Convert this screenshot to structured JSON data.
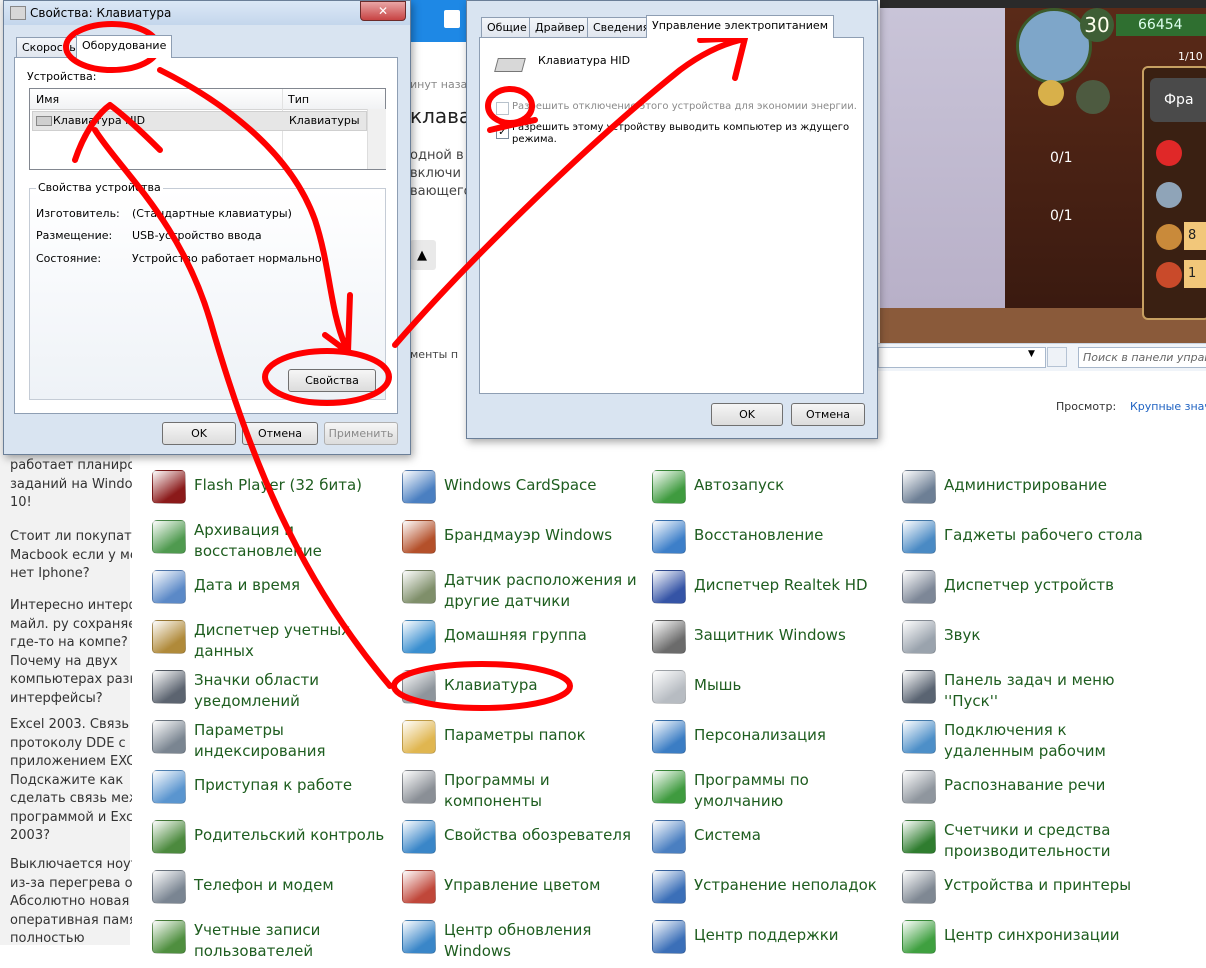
{
  "left_articles": [
    {
      "lines": [
        "работает планиро",
        "заданий на Window",
        "10!"
      ]
    },
    {
      "lines": [
        "Стоит ли покупать",
        "Macbook если у ме",
        "нет Iphone?"
      ]
    },
    {
      "lines": [
        "Интересно интерф",
        "майл. ру сохраняе",
        "где-то на компе?",
        "Почему на двух",
        "компьютерах разн",
        "интерфейсы?"
      ]
    },
    {
      "lines": [
        "Excel 2003. Связь",
        "протоколу DDE с",
        "приложением EXC",
        "Подскажите как",
        "сделать связь меж",
        "программой и Exce",
        "2003?"
      ]
    },
    {
      "lines": [
        "Выключается ноут",
        "из-за перегрева оз",
        "Абсолютно новая",
        "оперативная памя",
        "полностью"
      ]
    }
  ],
  "web_strip": {
    "texts": [
      "инут наза",
      "клава",
      "одной в",
      "включи",
      "вающего",
      "менты п"
    ]
  },
  "game": {
    "level": "30",
    "gold": "66454",
    "counter": "1/10",
    "key1": "0/1",
    "key2": "0/1",
    "panel_label": "Фра",
    "stat1": "8",
    "stat2": "1"
  },
  "control_panel": {
    "search_placeholder": "Поиск в панели управ",
    "view_label": "Просмотр:",
    "view_value": "Крупные знач",
    "items": [
      {
        "label": "Flash Player (32 бита)",
        "icon": "flash-icon",
        "color": "#8b1a1a"
      },
      {
        "label": "Windows CardSpace",
        "icon": "cardspace-icon",
        "color": "#4a7fc1"
      },
      {
        "label": "Автозапуск",
        "icon": "autoplay-icon",
        "color": "#3f9b3f"
      },
      {
        "label": "Администрирование",
        "icon": "admin-tools-icon",
        "color": "#6d7f95"
      },
      {
        "label": "Архивация и\nвосстановление",
        "icon": "backup-icon",
        "color": "#4f9a4f"
      },
      {
        "label": "Брандмауэр Windows",
        "icon": "firewall-icon",
        "color": "#b4502a"
      },
      {
        "label": "Восстановление",
        "icon": "recovery-icon",
        "color": "#3d7fc9"
      },
      {
        "label": "Гаджеты рабочего стола",
        "icon": "gadgets-icon",
        "color": "#4a8ac4"
      },
      {
        "label": "Дата и время",
        "icon": "datetime-icon",
        "color": "#5b89c7"
      },
      {
        "label": "Датчик расположения и\nдругие датчики",
        "icon": "sensor-icon",
        "color": "#7f8f6a"
      },
      {
        "label": "Диспетчер Realtek HD",
        "icon": "realtek-icon",
        "color": "#3554a6"
      },
      {
        "label": "Диспетчер устройств",
        "icon": "device-manager-icon",
        "color": "#7d8797"
      },
      {
        "label": "Диспетчер учетных\nданных",
        "icon": "credential-icon",
        "color": "#b08a3a"
      },
      {
        "label": "Домашняя группа",
        "icon": "homegroup-icon",
        "color": "#3a8fd0"
      },
      {
        "label": "Защитник Windows",
        "icon": "defender-icon",
        "color": "#6b6b6b"
      },
      {
        "label": "Звук",
        "icon": "sound-icon",
        "color": "#9aa3ad"
      },
      {
        "label": "Значки области\nуведомлений",
        "icon": "notification-icon",
        "color": "#5c6470"
      },
      {
        "label": "Клавиатура",
        "icon": "keyboard-icon",
        "color": "#8e959c"
      },
      {
        "label": "Мышь",
        "icon": "mouse-icon",
        "color": "#b7bcc2"
      },
      {
        "label": "Панель задач и меню\n''Пуск''",
        "icon": "taskbar-icon",
        "color": "#5a6472"
      },
      {
        "label": "Параметры\nиндексирования",
        "icon": "indexing-icon",
        "color": "#7a8591"
      },
      {
        "label": "Параметры папок",
        "icon": "folder-options-icon",
        "color": "#e0b650"
      },
      {
        "label": "Персонализация",
        "icon": "personalization-icon",
        "color": "#3b7dc4"
      },
      {
        "label": "Подключения к\nудаленным рабочим",
        "icon": "remote-desktop-icon",
        "color": "#4d8fc8"
      },
      {
        "label": "Приступая к работе",
        "icon": "getting-started-icon",
        "color": "#5a95cf"
      },
      {
        "label": "Программы и\nкомпоненты",
        "icon": "programs-icon",
        "color": "#8a8f96"
      },
      {
        "label": "Программы по\nумолчанию",
        "icon": "default-programs-icon",
        "color": "#3f9b3f"
      },
      {
        "label": "Распознавание речи",
        "icon": "speech-icon",
        "color": "#8f969e"
      },
      {
        "label": "Родительский контроль",
        "icon": "parental-icon",
        "color": "#4c8a3e"
      },
      {
        "label": "Свойства обозревателя",
        "icon": "internet-options-icon",
        "color": "#3a86c8"
      },
      {
        "label": "Система",
        "icon": "system-icon",
        "color": "#4a7fc1"
      },
      {
        "label": "Счетчики и средства\nпроизводительности",
        "icon": "performance-icon",
        "color": "#2f7d2f"
      },
      {
        "label": "Телефон и модем",
        "icon": "phone-modem-icon",
        "color": "#7a8592"
      },
      {
        "label": "Управление цветом",
        "icon": "color-management-icon",
        "color": "#c0473a"
      },
      {
        "label": "Устранение неполадок",
        "icon": "troubleshooting-icon",
        "color": "#3b6fb8"
      },
      {
        "label": "Устройства и принтеры",
        "icon": "printers-icon",
        "color": "#7f8893"
      },
      {
        "label": "Учетные записи\nпользователей",
        "icon": "user-accounts-icon",
        "color": "#4f8f3f"
      },
      {
        "label": "Центр обновления\nWindows",
        "icon": "windows-update-icon",
        "color": "#3a86c8"
      },
      {
        "label": "Центр поддержки",
        "icon": "action-center-icon",
        "color": "#3b6fb8"
      },
      {
        "label": "Центр синхронизации",
        "icon": "sync-center-icon",
        "color": "#3fa040"
      }
    ]
  },
  "dialog1": {
    "title": "Свойства: Клавиатура",
    "tabs": [
      "Скорость",
      "Оборудование"
    ],
    "devices_label": "Устройства:",
    "col_name": "Имя",
    "col_type": "Тип",
    "device_name": "Клавиатура HID",
    "device_type": "Клавиатуры",
    "props_group": "Свойства устройства",
    "manufacturer_label": "Изготовитель:",
    "manufacturer_value": "(Стандартные клавиатуры)",
    "location_label": "Размещение:",
    "location_value": "USB-устройство ввода",
    "status_label": "Состояние:",
    "status_value": "Устройство работает нормально.",
    "properties_button": "Свойства",
    "ok": "OK",
    "cancel": "Отмена",
    "apply": "Применить"
  },
  "dialog2": {
    "tabs": [
      "Общие",
      "Драйвер",
      "Сведения",
      "Управление электропитанием"
    ],
    "device_name": "Клавиатура HID",
    "option1": "Разрешить отключение этого устройства для экономии энергии.",
    "option2_line1": "Разрешить этому устройству выводить компьютер из ждущего",
    "option2_line2": "режима.",
    "ok": "OK",
    "cancel": "Отмена"
  },
  "colors": {
    "annotation": "#ff0000",
    "cp_link": "#1e5d1f",
    "dialog_bg": "#d9e4f1"
  }
}
